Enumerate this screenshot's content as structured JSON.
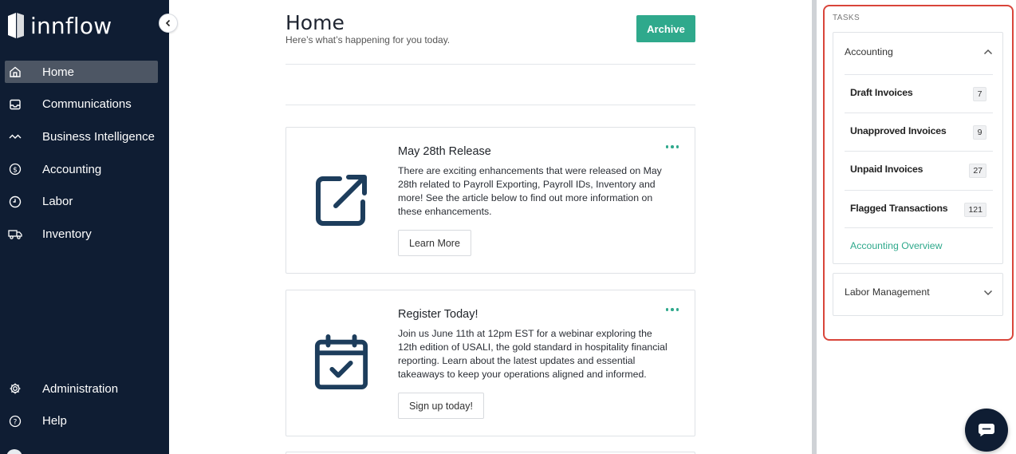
{
  "app": {
    "logo_text": "innflow"
  },
  "sidebar": {
    "items": [
      {
        "label": "Home",
        "icon": "home-icon",
        "active": true
      },
      {
        "label": "Communications",
        "icon": "inbox-icon"
      },
      {
        "label": "Business Intelligence",
        "icon": "trend-icon"
      },
      {
        "label": "Accounting",
        "icon": "dollar-circle-icon"
      },
      {
        "label": "Labor",
        "icon": "clock-icon"
      },
      {
        "label": "Inventory",
        "icon": "truck-icon"
      }
    ],
    "bottom_items": [
      {
        "label": "Administration",
        "icon": "gear-icon"
      },
      {
        "label": "Help",
        "icon": "help-circle-icon"
      }
    ]
  },
  "main": {
    "title": "Home",
    "subtitle": "Here’s what’s happening for you today.",
    "archive_label": "Archive",
    "cards": [
      {
        "title": "May 28th Release",
        "body": "There are exciting enhancements that were released on May 28th related to Payroll Exporting, Payroll IDs, Inventory and more! See the article below to find out more information on these enhancements.",
        "button": "Learn More",
        "icon": "external-link-icon"
      },
      {
        "title": "Register Today!",
        "body": "Join us June 11th at 12pm EST for a webinar exploring the 12th edition of USALI, the gold standard in hospitality financial reporting. Learn about the latest updates and essential takeaways to keep your operations aligned and informed.",
        "button": "Sign up today!",
        "icon": "calendar-check-icon"
      }
    ]
  },
  "tasks": {
    "label": "TASKS",
    "accounting": {
      "header": "Accounting",
      "expanded": true,
      "items": [
        {
          "name": "Draft Invoices",
          "count": "7"
        },
        {
          "name": "Unapproved Invoices",
          "count": "9"
        },
        {
          "name": "Unpaid Invoices",
          "count": "27"
        },
        {
          "name": "Flagged Transactions",
          "count": "121"
        }
      ],
      "link": "Accounting Overview"
    },
    "labor": {
      "header": "Labor Management",
      "expanded": false
    }
  },
  "colors": {
    "sidebar_bg": "#0f1d33",
    "accent": "#2fa98c",
    "highlight_border": "#d9453a",
    "icon_navy": "#1d3d5c"
  }
}
